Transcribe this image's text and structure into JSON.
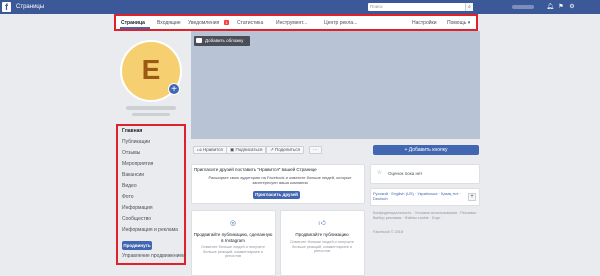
{
  "topbar": {
    "logo": "f",
    "title": "Страницы",
    "search_placeholder": "Поиск",
    "search_icon": "search-icon",
    "icons": [
      "notifications-icon",
      "flag-icon",
      "settings-icon"
    ]
  },
  "page_nav": {
    "items": [
      {
        "label": "Страница",
        "active": true
      },
      {
        "label": "Входящие"
      },
      {
        "label": "Уведомления"
      },
      {
        "label": "Статистика"
      },
      {
        "label": "Инструмент..."
      },
      {
        "label": "Центр рекла..."
      },
      {
        "label": "Настройки"
      },
      {
        "label": "Помощь ▾"
      }
    ],
    "notifications_badge": "1"
  },
  "profile": {
    "avatar_letter": "E",
    "avatar_add_icon": "+"
  },
  "sidebar": {
    "items": [
      {
        "label": "Главная",
        "active": true
      },
      {
        "label": "Публикации"
      },
      {
        "label": "Отзывы"
      },
      {
        "label": "Мероприятия"
      },
      {
        "label": "Вакансии"
      },
      {
        "label": "Видео"
      },
      {
        "label": "Фото"
      },
      {
        "label": "Информация"
      },
      {
        "label": "Сообщество"
      },
      {
        "label": "Информация и реклама"
      }
    ],
    "promote_label": "Продвинуть",
    "manage_label": "Управление продвижением"
  },
  "cover": {
    "add_cover_label": "Добавить обложку"
  },
  "actions": {
    "like": "Нравится",
    "follow": "Подписаться",
    "share": "Поделиться",
    "more": "···",
    "add_button": "+ Добавить кнопку"
  },
  "invite": {
    "title": "Пригласите друзей поставить \"Нравится\" вашей Странице",
    "text": "Расширьте свою аудиторию на Facebook и охватите больше людей, которые заинтересуют ваша компания",
    "button": "Пригласить друзей"
  },
  "promos": [
    {
      "icon": "instagram-icon",
      "title": "Продвигайте публикацию, сделанную в Instagram",
      "text": "Охватите больше людей и получите больше реакций, комментариев и репостов"
    },
    {
      "icon": "thumbs-up-icon",
      "title": "Продвигайте публикацию",
      "text": "Охватите больше людей и получите больше реакций, комментариев и репостов"
    }
  ],
  "rating": {
    "text": "Оценок пока нет"
  },
  "languages": {
    "text": "Русский · English (US) · Українська · Қазақ тілі · Deutsch",
    "add_icon": "+"
  },
  "footer": {
    "text": "Конфиденциальность · Условия использования · Реклама · Выбор рекламы · Файлы cookie · Еще ·",
    "copyright": "Facebook © 2018"
  }
}
